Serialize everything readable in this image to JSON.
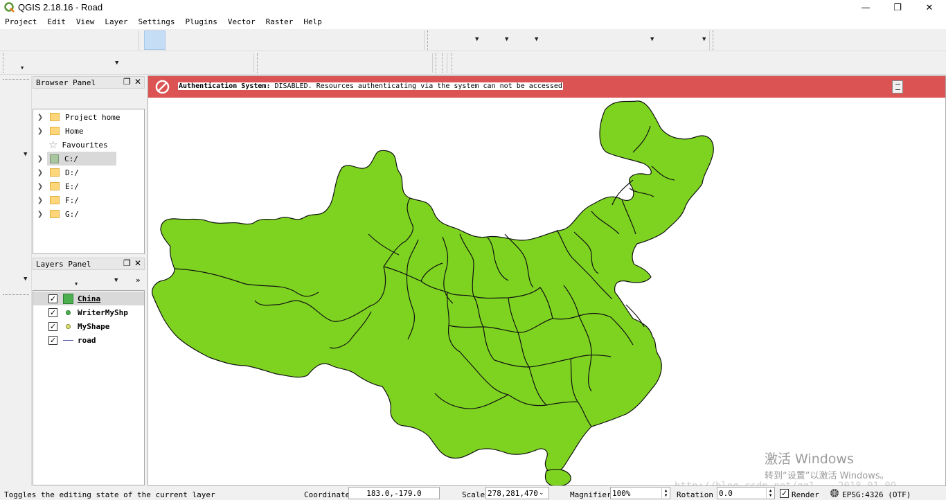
{
  "window": {
    "title": "QGIS 2.18.16 - Road",
    "minimize": "—",
    "maximize": "❐",
    "close": "✕"
  },
  "menu": [
    "Project",
    "Edit",
    "View",
    "Layer",
    "Settings",
    "Plugins",
    "Vector",
    "Raster",
    "Help"
  ],
  "browser_panel": {
    "title": "Browser Panel",
    "items": [
      {
        "label": "Project home",
        "type": "folder",
        "expandable": true
      },
      {
        "label": "Home",
        "type": "folder",
        "expandable": true
      },
      {
        "label": "Favourites",
        "type": "favourites",
        "expandable": false
      },
      {
        "label": "C:/",
        "type": "drive",
        "expandable": true,
        "selected": true
      },
      {
        "label": "D:/",
        "type": "folder",
        "expandable": true
      },
      {
        "label": "E:/",
        "type": "folder",
        "expandable": true
      },
      {
        "label": "F:/",
        "type": "folder",
        "expandable": true
      },
      {
        "label": "G:/",
        "type": "folder",
        "expandable": true
      }
    ]
  },
  "layers_panel": {
    "title": "Layers Panel",
    "more": "»",
    "layers": [
      {
        "name": "China",
        "checked": true,
        "symbol": "fill",
        "color": "#4caf50",
        "selected": true
      },
      {
        "name": "WriterMyShp",
        "checked": true,
        "symbol": "point",
        "color": "#4caf50"
      },
      {
        "name": "MyShape",
        "checked": true,
        "symbol": "point",
        "color": "#c8c850"
      },
      {
        "name": "road",
        "checked": true,
        "symbol": "line",
        "color": "#5555aa"
      }
    ]
  },
  "auth_message": {
    "label": "Authentication System",
    "separator": ":",
    "text": "DISABLED. Resources authenticating via the system can not be accessed"
  },
  "statusbar": {
    "message": "Toggles the editing state of the current layer",
    "coordinate_label": "Coordinate",
    "coordinate_value": "183.0,-179.0",
    "scale_label": "Scale",
    "scale_value": "278,281,470",
    "magnifier_label": "Magnifier",
    "magnifier_value": "100%",
    "rotation_label": "Rotation",
    "rotation_value": "0.0",
    "render_label": "Render",
    "crs_label": "EPSG:4326 (OTF)"
  },
  "watermark": {
    "activate_title": "激活 Windows",
    "activate_sub": "转到“设置”以激活 Windows。",
    "url": "http://blog.csdn.net/qq1... 2018_01_09"
  },
  "colors": {
    "map_fill": "#7ed321",
    "auth_bar": "#dc5353",
    "china_swatch": "#4caf50"
  }
}
